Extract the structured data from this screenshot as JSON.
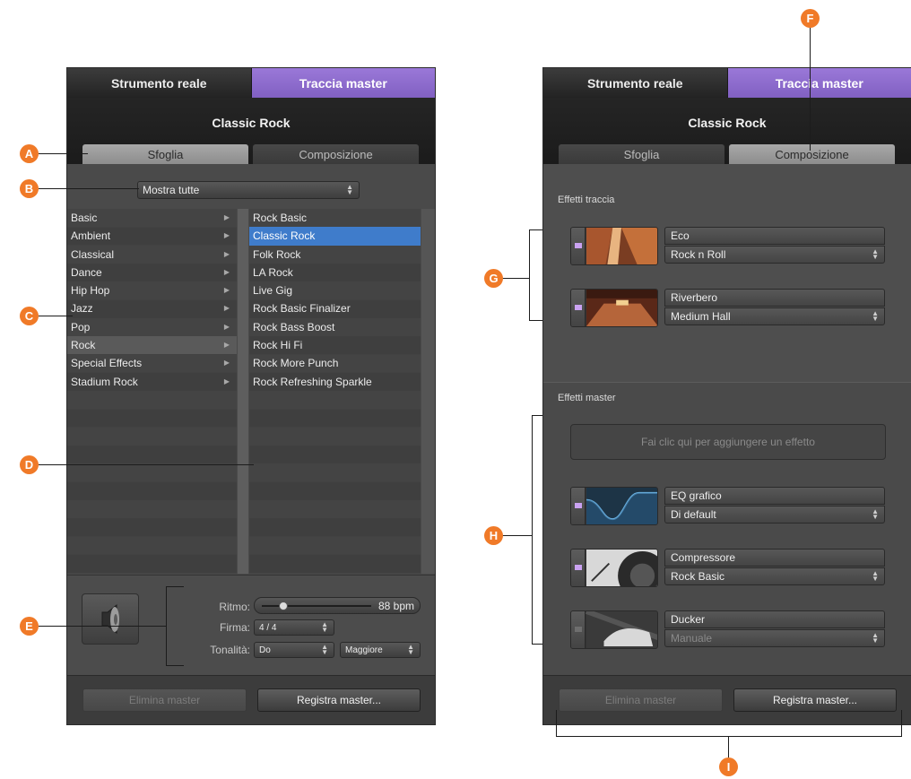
{
  "left": {
    "tabs": [
      "Strumento reale",
      "Traccia master"
    ],
    "title": "Classic Rock",
    "subtabs": [
      "Sfoglia",
      "Composizione"
    ],
    "filter": "Mostra tutte",
    "categories": [
      "Basic",
      "Ambient",
      "Classical",
      "Dance",
      "Hip Hop",
      "Jazz",
      "Pop",
      "Rock",
      "Special Effects",
      "Stadium Rock"
    ],
    "selected_category": "Rock",
    "presets": [
      "Rock Basic",
      "Classic Rock",
      "Folk Rock",
      "LA Rock",
      "Live Gig",
      "Rock Basic Finalizer",
      "Rock Bass Boost",
      "Rock Hi Fi",
      "Rock More Punch",
      "Rock Refreshing Sparkle"
    ],
    "selected_preset": "Classic Rock",
    "tempo_label": "Ritmo:",
    "tempo_value": "88 bpm",
    "tempo_level": 0.2,
    "signature_label": "Firma:",
    "signature_value": "4 / 4",
    "key_label": "Tonalità:",
    "key_value": "Do",
    "mode_value": "Maggiore",
    "delete_button": "Elimina master",
    "save_button": "Registra master..."
  },
  "right": {
    "tabs": [
      "Strumento reale",
      "Traccia master"
    ],
    "title": "Classic Rock",
    "subtabs": [
      "Sfoglia",
      "Composizione"
    ],
    "track_effects_label": "Effetti traccia",
    "track_effects": [
      {
        "name": "Eco",
        "preset": "Rock n Roll",
        "enabled": true
      },
      {
        "name": "Riverbero",
        "preset": "Medium Hall",
        "enabled": true
      }
    ],
    "master_effects_label": "Effetti master",
    "add_effect": "Fai clic qui per aggiungere un effetto",
    "master_effects": [
      {
        "name": "EQ grafico",
        "preset": "Di default",
        "enabled": true
      },
      {
        "name": "Compressore",
        "preset": "Rock Basic",
        "enabled": true
      },
      {
        "name": "Ducker",
        "preset": "Manuale",
        "enabled": false
      }
    ],
    "delete_button": "Elimina master",
    "save_button": "Registra master..."
  },
  "callouts": [
    "A",
    "B",
    "C",
    "D",
    "E",
    "F",
    "G",
    "H",
    "I"
  ],
  "colors": {
    "callout": "#f07a28",
    "accent_tab": "#8a68c9",
    "selection": "#3f7ccb",
    "led": "#caa2f2"
  }
}
